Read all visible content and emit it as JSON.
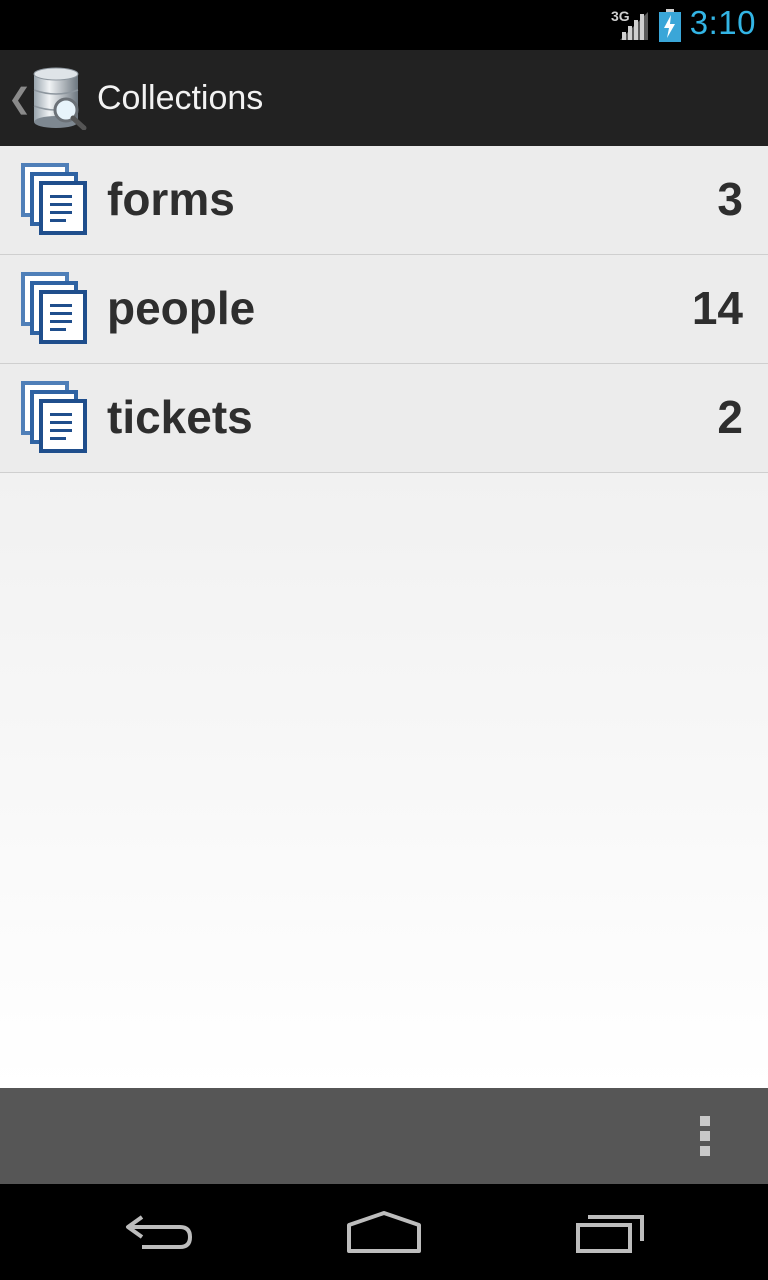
{
  "status_bar": {
    "network": "3G",
    "clock": "3:10",
    "icons": [
      "signal-icon",
      "battery-charging-icon"
    ]
  },
  "action_bar": {
    "title": "Collections",
    "icons": [
      "up-caret-icon",
      "database-search-icon"
    ]
  },
  "collections": [
    {
      "name": "forms",
      "count": "3"
    },
    {
      "name": "people",
      "count": "14"
    },
    {
      "name": "tickets",
      "count": "2"
    }
  ],
  "bottom_bar": {
    "icons": [
      "overflow-menu-icon"
    ]
  },
  "nav_bar": {
    "icons": [
      "back-icon",
      "home-icon",
      "recents-icon"
    ]
  },
  "colors": {
    "accent": "#33b5e5",
    "action_bar_bg": "#222222",
    "bottom_bar_bg": "#565656",
    "doc_icon_blue": "#1f4e8c"
  }
}
